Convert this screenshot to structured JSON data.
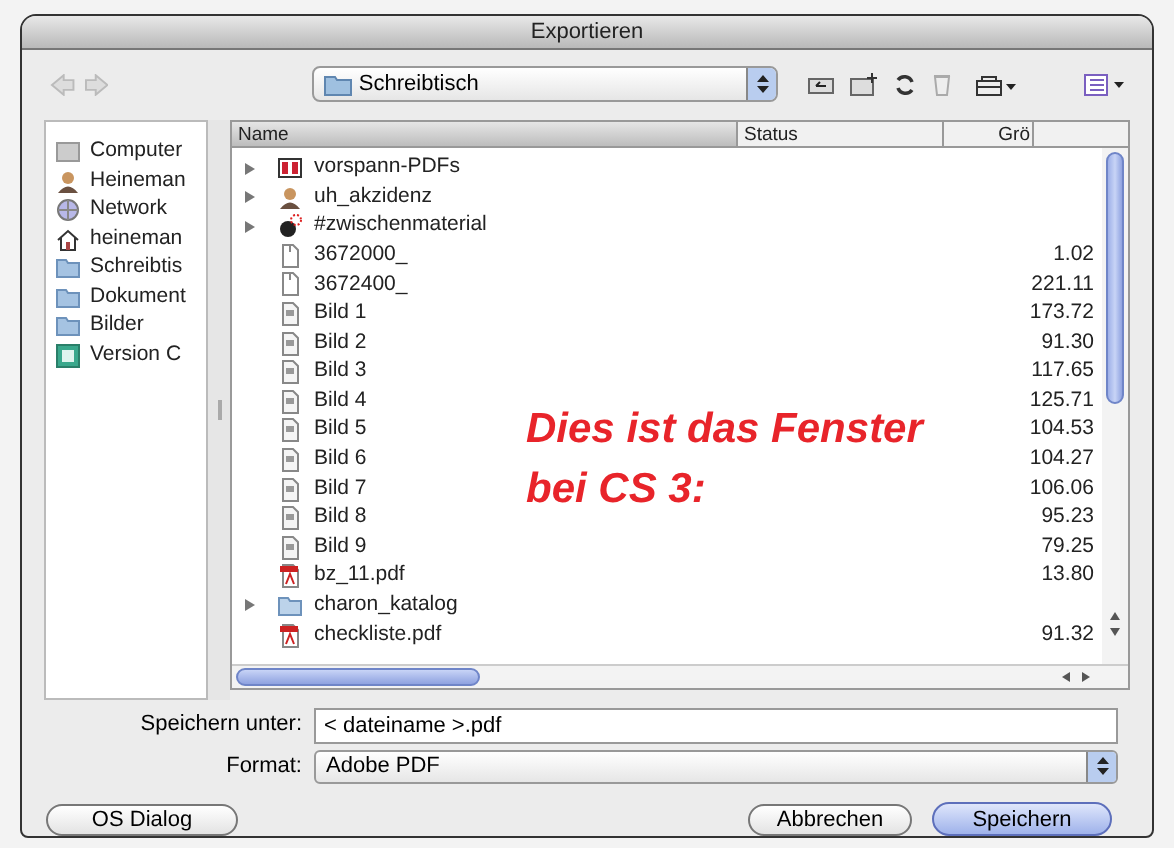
{
  "window": {
    "title": "Exportieren"
  },
  "toolbar": {
    "location": "Schreibtisch"
  },
  "sidebar": {
    "items": [
      {
        "label": "Computer",
        "kind": "computer"
      },
      {
        "label": "Heineman",
        "kind": "user"
      },
      {
        "label": "Network",
        "kind": "network"
      },
      {
        "label": "heineman",
        "kind": "home"
      },
      {
        "label": "Schreibtis",
        "kind": "folder"
      },
      {
        "label": "Dokument",
        "kind": "folder"
      },
      {
        "label": "Bilder",
        "kind": "folder"
      },
      {
        "label": "Version C",
        "kind": "disk"
      }
    ]
  },
  "table": {
    "columns": [
      "Name",
      "Status",
      "Grö"
    ],
    "rows": [
      {
        "name": "vorspann-PDFs",
        "kind": "custom",
        "disclosure": true
      },
      {
        "name": "uh_akzidenz",
        "kind": "user",
        "disclosure": true
      },
      {
        "name": "#zwischenmaterial",
        "kind": "bomb",
        "disclosure": true
      },
      {
        "name": "3672000_",
        "kind": "doc",
        "disclosure": false,
        "size": "1.02"
      },
      {
        "name": "3672400_",
        "kind": "doc",
        "disclosure": false,
        "size": "221.11"
      },
      {
        "name": "Bild 1",
        "kind": "image",
        "disclosure": false,
        "size": "173.72"
      },
      {
        "name": "Bild 2",
        "kind": "image",
        "disclosure": false,
        "size": "91.30"
      },
      {
        "name": "Bild 3",
        "kind": "image",
        "disclosure": false,
        "size": "117.65"
      },
      {
        "name": "Bild 4",
        "kind": "image",
        "disclosure": false,
        "size": "125.71"
      },
      {
        "name": "Bild 5",
        "kind": "image",
        "disclosure": false,
        "size": "104.53"
      },
      {
        "name": "Bild 6",
        "kind": "image",
        "disclosure": false,
        "size": "104.27"
      },
      {
        "name": "Bild 7",
        "kind": "image",
        "disclosure": false,
        "size": "106.06"
      },
      {
        "name": "Bild 8",
        "kind": "image",
        "disclosure": false,
        "size": "95.23"
      },
      {
        "name": "Bild 9",
        "kind": "image",
        "disclosure": false,
        "size": "79.25"
      },
      {
        "name": "bz_11.pdf",
        "kind": "pdf",
        "disclosure": false,
        "size": "13.80"
      },
      {
        "name": "charon_katalog",
        "kind": "folder",
        "disclosure": true
      },
      {
        "name": "checkliste.pdf",
        "kind": "pdf",
        "disclosure": false,
        "size": "91.32"
      }
    ]
  },
  "annotation": [
    "Dies ist das Fenster",
    "bei CS 3:"
  ],
  "save_as": {
    "label": "Speichern unter:",
    "value": "< dateiname >.pdf"
  },
  "format": {
    "label": "Format:",
    "value": "Adobe PDF"
  },
  "buttons": {
    "os_dialog": "OS Dialog",
    "cancel": "Abbrechen",
    "save": "Speichern"
  }
}
